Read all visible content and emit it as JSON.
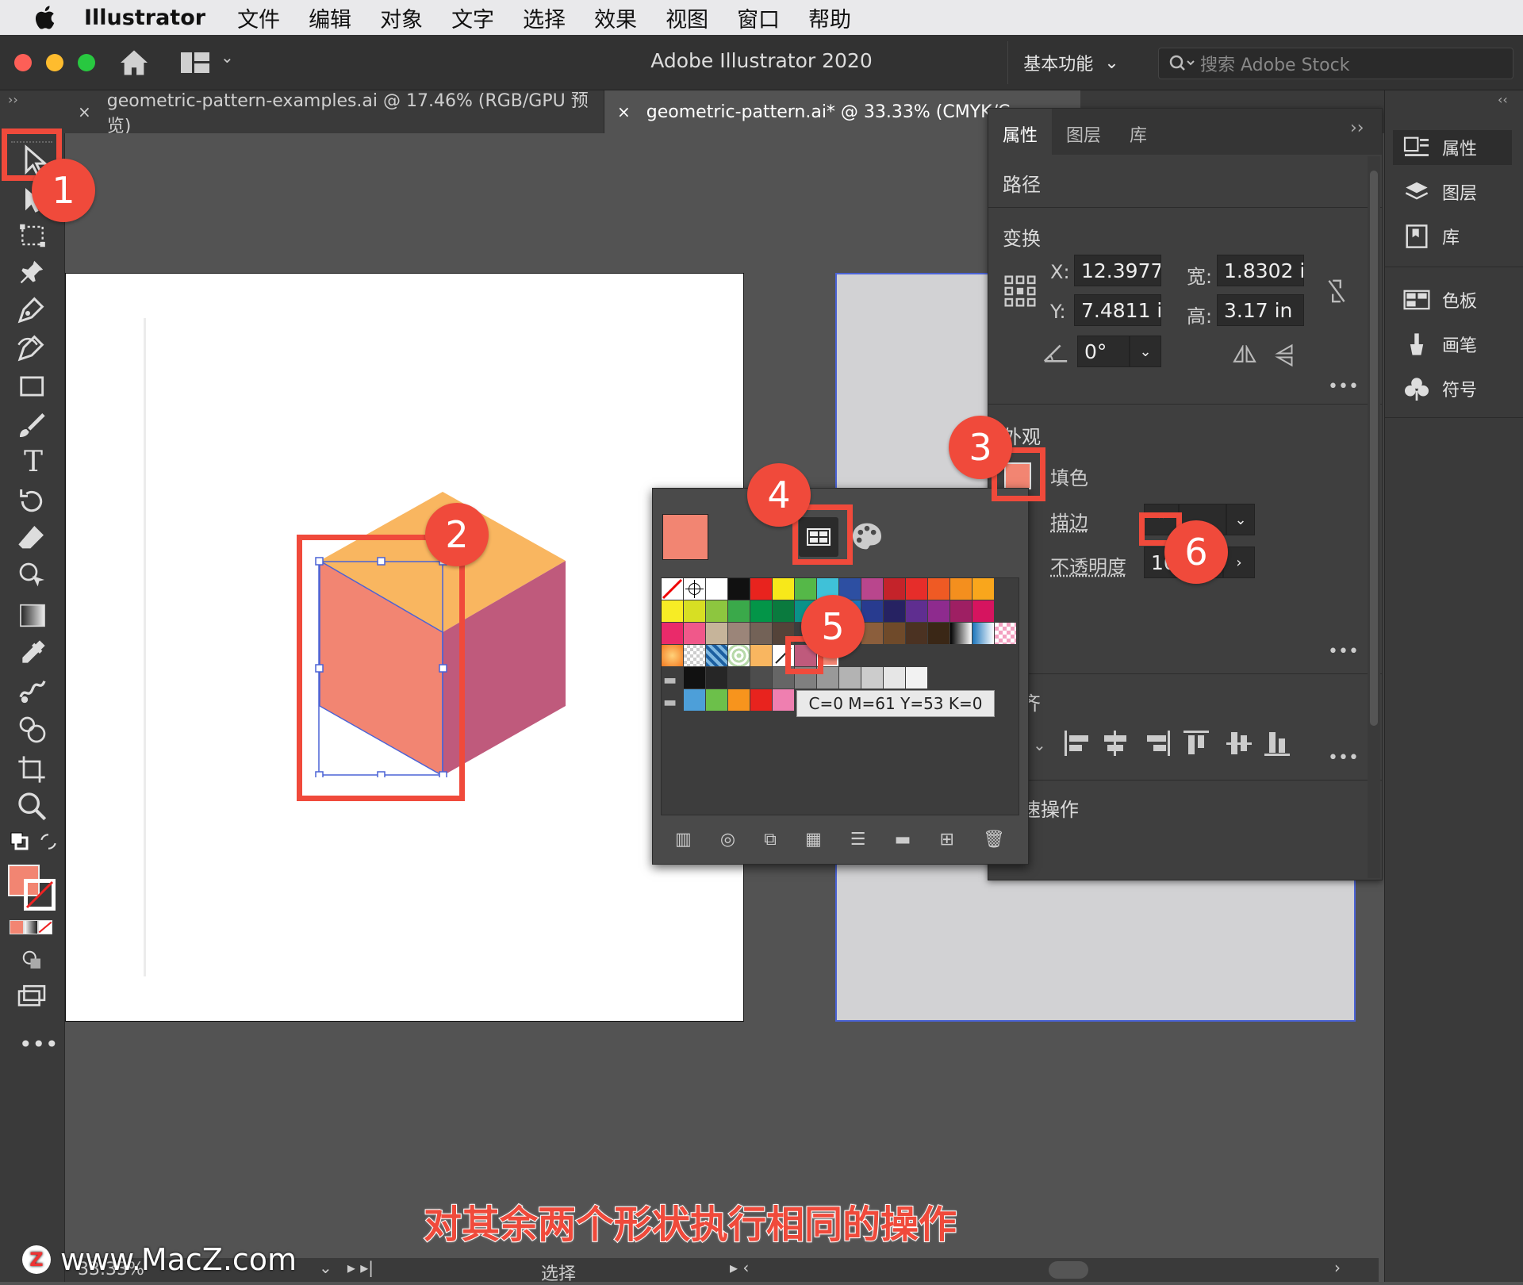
{
  "menubar": {
    "app": "Illustrator",
    "items": [
      "文件",
      "编辑",
      "对象",
      "文字",
      "选择",
      "效果",
      "视图",
      "窗口",
      "帮助"
    ]
  },
  "titlebar": {
    "title": "Adobe Illustrator 2020",
    "workspace": "基本功能",
    "stock_placeholder": "搜索 Adobe Stock"
  },
  "tabs": [
    {
      "label": "geometric-pattern-examples.ai @ 17.46% (RGB/GPU 预览)"
    },
    {
      "label": "geometric-pattern.ai* @ 33.33% (CMYK/C"
    }
  ],
  "colors": {
    "accent": "#f04a3b",
    "fill": "#f28572",
    "cube_top": "#f9b660",
    "cube_side": "#bf5a7c",
    "cube_front": "#f28572",
    "selection": "#4b63d6"
  },
  "props": {
    "tabs": [
      "属性",
      "图层",
      "库"
    ],
    "object_type": "路径",
    "transform_title": "变换",
    "x_label": "X:",
    "x_value": "12.3977",
    "y_label": "Y:",
    "y_value": "7.4811 i",
    "w_label": "宽:",
    "w_value": "1.8302 ir",
    "h_label": "高:",
    "h_value": "3.17 in",
    "angle_value": "0°",
    "appearance_title": "外观",
    "fill_label": "填色",
    "stroke_label": "描边",
    "opacity_label": "不透明度",
    "opacity_value": "10",
    "quick_title": "快速操作",
    "align_title": "对齐"
  },
  "dock": {
    "items": [
      "属性",
      "图层",
      "库",
      "色板",
      "画笔",
      "符号"
    ]
  },
  "swatches": {
    "tooltip": "C=0 M=61 Y=53 K=0"
  },
  "callouts": [
    "1",
    "2",
    "3",
    "4",
    "5",
    "6"
  ],
  "status": {
    "zoom": "33.33%",
    "mode": "选择"
  },
  "caption": "对其余两个形状执行相同的操作",
  "watermark": "www.MacZ.com"
}
